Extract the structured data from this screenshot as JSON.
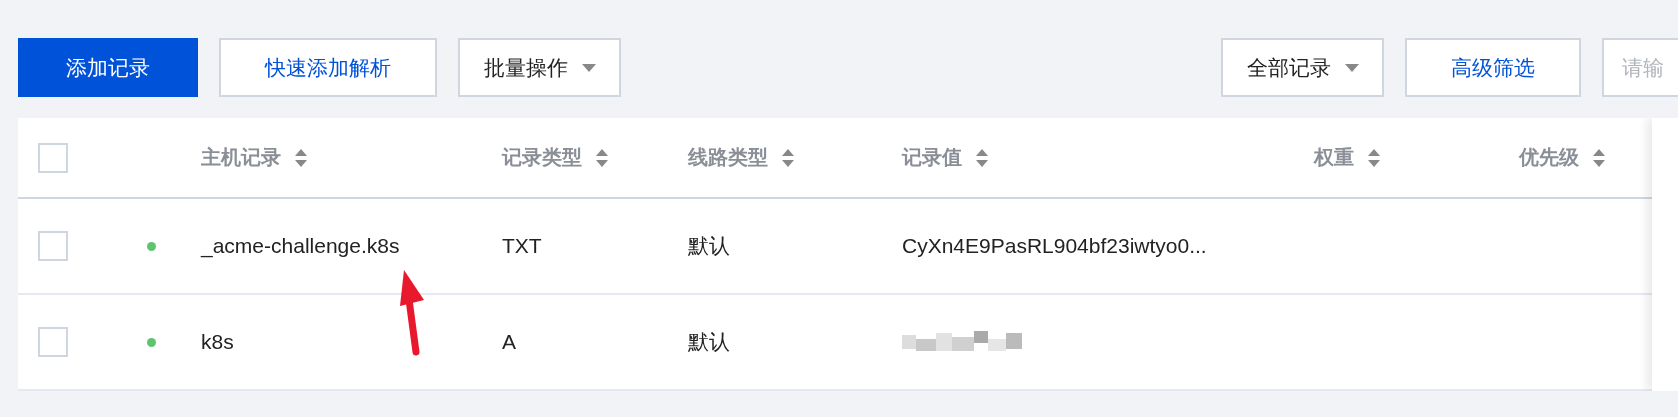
{
  "toolbar": {
    "left_buttons": [
      {
        "label": "添加记录",
        "kind": "primary"
      },
      {
        "label": "快速添加解析",
        "kind": "link"
      },
      {
        "label": "批量操作",
        "kind": "dropdown"
      }
    ],
    "right_buttons": [
      {
        "label": "全部记录",
        "kind": "dropdown"
      },
      {
        "label": "高级筛选",
        "kind": "link"
      }
    ],
    "search": {
      "placeholder": "请输"
    }
  },
  "table": {
    "columns": [
      {
        "label": "主机记录",
        "sortable": true
      },
      {
        "label": "记录类型",
        "sortable": true
      },
      {
        "label": "线路类型",
        "sortable": true
      },
      {
        "label": "记录值",
        "sortable": true
      },
      {
        "label": "权重",
        "sortable": true
      },
      {
        "label": "优先级",
        "sortable": true
      }
    ],
    "select_all": {
      "checked": false
    },
    "rows": [
      {
        "checked": false,
        "color": "#5fc46f",
        "host": "_acme-challenge.k8s",
        "type": "TXT",
        "line": "默认",
        "value": "CyXn4E9PasRL904bf23iwtyo0...",
        "value_hidden": false
      },
      {
        "checked": false,
        "color": "#5fc46f",
        "host": "k8s",
        "type": "A",
        "line": "默认",
        "value_hidden": true
      }
    ]
  },
  "annotation": {
    "kind": "arrow",
    "color": "#e8192c"
  }
}
